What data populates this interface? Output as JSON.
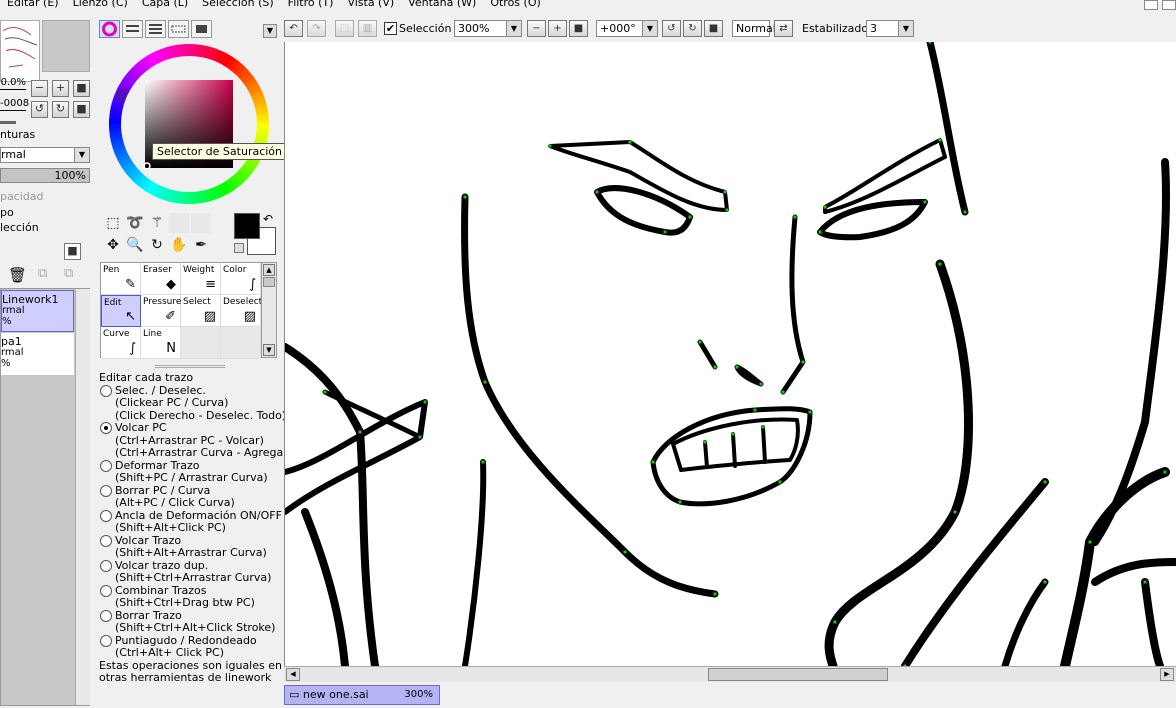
{
  "menu": [
    "Editar (E)",
    "Lienzo (C)",
    "Capa (L)",
    "Selección (S)",
    "Filtro (T)",
    "Vista (V)",
    "Ventana (W)",
    "Otros (O)"
  ],
  "navigator": {
    "zoom": "0.0%",
    "angle": "-0008"
  },
  "layer_props": {
    "texture_label": "nturas",
    "blend_mode": "rmal",
    "opacity": "100%",
    "opacity_label": "pacidad",
    "group_label": "po",
    "selection_label": "lección"
  },
  "layers": [
    {
      "name": "Linework1",
      "mode": "rmal",
      "opacity": "%",
      "selected": true
    },
    {
      "name": "pa1",
      "mode": "rmal",
      "opacity": "%",
      "selected": false
    }
  ],
  "color": {
    "tooltip": "Selector de Saturación / Valor",
    "foreground": "#000000",
    "background": "#ffffff",
    "hue_marker": "#c8004a"
  },
  "tools": [
    {
      "label": "Pen",
      "icon": "pen-icon",
      "glyph": "✎"
    },
    {
      "label": "Eraser",
      "icon": "eraser-icon",
      "glyph": "◆"
    },
    {
      "label": "Weight",
      "icon": "weight-icon",
      "glyph": "≡"
    },
    {
      "label": "Color",
      "icon": "color-icon",
      "glyph": "∫"
    },
    {
      "label": "Edit",
      "icon": "edit-icon",
      "glyph": "↖",
      "active": true
    },
    {
      "label": "Pressure",
      "icon": "pressure-icon",
      "glyph": "✐"
    },
    {
      "label": "Select",
      "icon": "select-icon",
      "glyph": "▨"
    },
    {
      "label": "Deselect",
      "icon": "deselect-icon",
      "glyph": "▨"
    },
    {
      "label": "Curve",
      "icon": "curve-icon",
      "glyph": "∫"
    },
    {
      "label": "Line",
      "icon": "line-icon",
      "glyph": "N"
    }
  ],
  "edit_section": {
    "title": "Editar cada trazo",
    "options": [
      {
        "label": "Selec. / Deselec.",
        "hints": [
          "(Clickear PC / Curva)",
          "(Click Derecho - Deselec. Todo)"
        ],
        "checked": false
      },
      {
        "label": "Volcar PC",
        "hints": [
          "(Ctrl+Arrastrar PC - Volcar)",
          "(Ctrl+Arrastrar Curva - Agregar/V"
        ],
        "checked": true
      },
      {
        "label": "Deformar Trazo",
        "hints": [
          "(Shift+PC / Arrastrar Curva)"
        ],
        "checked": false
      },
      {
        "label": "Borrar PC / Curva",
        "hints": [
          "(Alt+PC / Click Curva)"
        ],
        "checked": false
      },
      {
        "label": "Ancla de Deformación ON/OFF",
        "hints": [
          "(Shift+Alt+Click PC)"
        ],
        "checked": false
      },
      {
        "label": "Volcar Trazo",
        "hints": [
          "(Shift+Alt+Arrastrar Curva)"
        ],
        "checked": false
      },
      {
        "label": "Volcar trazo dup.",
        "hints": [
          "(Shift+Ctrl+Arrastrar Curva)"
        ],
        "checked": false
      },
      {
        "label": "Combinar Trazos",
        "hints": [
          "(Shift+Ctrl+Drag btw PC)"
        ],
        "checked": false
      },
      {
        "label": "Borrar Trazo",
        "hints": [
          "(Shift+Ctrl+Alt+Click Stroke)"
        ],
        "checked": false
      },
      {
        "label": "Puntiagudo / Redondeado",
        "hints": [
          "(Ctrl+Alt+ Click PC)"
        ],
        "checked": false
      }
    ],
    "note": "Estas operaciones son iguales en otras herramientas de linework"
  },
  "toolbar": {
    "selection_label": "Selección",
    "selection_checked": true,
    "zoom": "300%",
    "rotation": "+000°",
    "mode": "Normal",
    "stabilizer_label": "Estabilizador",
    "stabilizer_value": "3"
  },
  "document": {
    "name": "new one.sai",
    "zoom": "300%"
  }
}
